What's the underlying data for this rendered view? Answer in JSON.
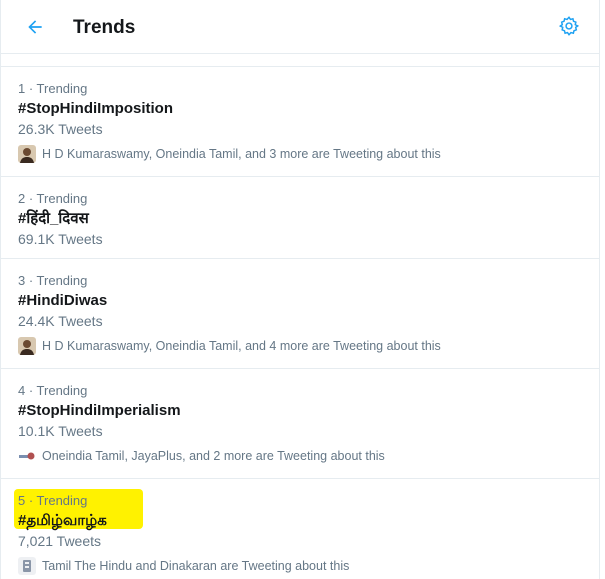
{
  "header": {
    "title": "Trends",
    "back_icon": "arrow-left-icon",
    "settings_icon": "gear-icon",
    "accent_color": "#1da1f2"
  },
  "trends": [
    {
      "rank": "1 · Trending",
      "hashtag": "#StopHindiImposition",
      "count": "26.3K Tweets",
      "context": "H D Kumaraswamy, Oneindia Tamil, and 3 more are Tweeting about this",
      "avatar": "person-avatar-icon"
    },
    {
      "rank": "2 · Trending",
      "hashtag": "#हिंदी_दिवस",
      "count": "69.1K Tweets"
    },
    {
      "rank": "3 · Trending",
      "hashtag": "#HindiDiwas",
      "count": "24.4K Tweets",
      "context": "H D Kumaraswamy, Oneindia Tamil, and 4 more are Tweeting about this",
      "avatar": "person-avatar-icon"
    },
    {
      "rank": "4 · Trending",
      "hashtag": "#StopHindiImperialism",
      "count": "10.1K Tweets",
      "context": "Oneindia Tamil, JayaPlus, and 2 more are Tweeting about this",
      "avatar": "logo-avatar-icon"
    },
    {
      "rank": "5 · Trending",
      "hashtag": "#தமிழ்வாழ்க",
      "count": "7,021 Tweets",
      "context": "Tamil The Hindu and Dinakaran are Tweeting about this",
      "avatar": "emblem-avatar-icon",
      "highlight_color": "#fff200"
    }
  ]
}
